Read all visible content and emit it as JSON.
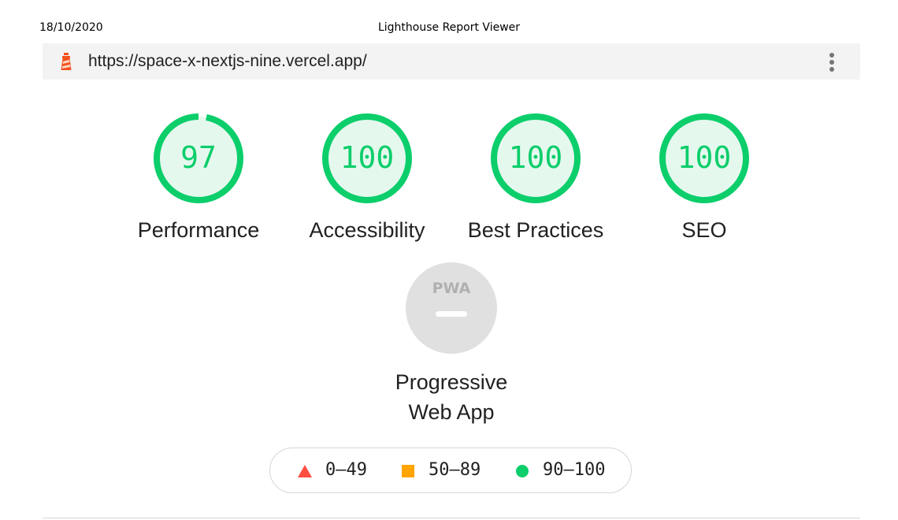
{
  "print_header": {
    "date": "18/10/2020",
    "title": "Lighthouse Report Viewer"
  },
  "topbar": {
    "url": "https://space-x-nextjs-nine.vercel.app/",
    "logo_icon": "lighthouse-icon",
    "menu_icon": "kebab-menu-icon"
  },
  "gauges": [
    {
      "score": 97,
      "label": "Performance"
    },
    {
      "score": 100,
      "label": "Accessibility"
    },
    {
      "score": 100,
      "label": "Best Practices"
    },
    {
      "score": 100,
      "label": "SEO"
    }
  ],
  "pwa": {
    "badge": "PWA",
    "label_line1": "Progressive",
    "label_line2": "Web App"
  },
  "legend": {
    "fail": {
      "range": "0–49",
      "color": "#ff4e42",
      "icon": "triangle-icon"
    },
    "average": {
      "range": "50–89",
      "color": "#ffa400",
      "icon": "square-icon"
    },
    "pass": {
      "range": "90–100",
      "color": "#0cce6b",
      "icon": "circle-icon"
    }
  },
  "colors": {
    "pass": "#0cce6b",
    "pass_fill": "#e5f8ee",
    "pwa_fill": "#e0e0e0",
    "pwa_mark": "#ffffff"
  }
}
